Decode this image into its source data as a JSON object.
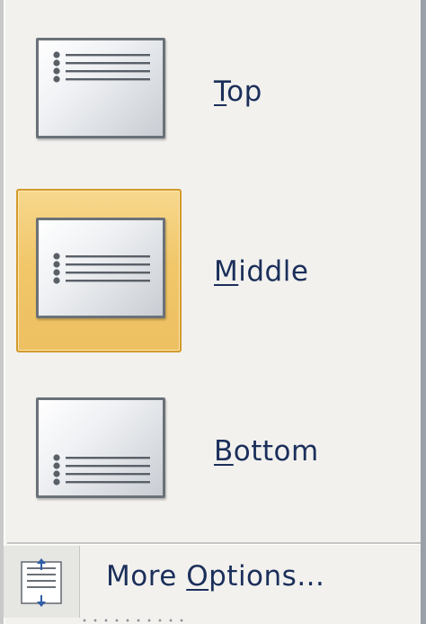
{
  "menu": {
    "options": [
      {
        "label_prefix": "",
        "label_accel": "T",
        "label_rest": "op",
        "selected": false
      },
      {
        "label_prefix": "",
        "label_accel": "M",
        "label_rest": "iddle",
        "selected": true
      },
      {
        "label_prefix": "",
        "label_accel": "B",
        "label_rest": "ottom",
        "selected": false
      }
    ],
    "more_options": {
      "label_prefix": "More ",
      "label_accel": "O",
      "label_rest": "ptions...",
      "icon": "text-alignment-options-icon"
    }
  },
  "colors": {
    "label_text": "#1b2f5a",
    "highlight_fill": "#f1c76a",
    "highlight_border": "#d49a2c",
    "background": "#f2f1ee"
  }
}
